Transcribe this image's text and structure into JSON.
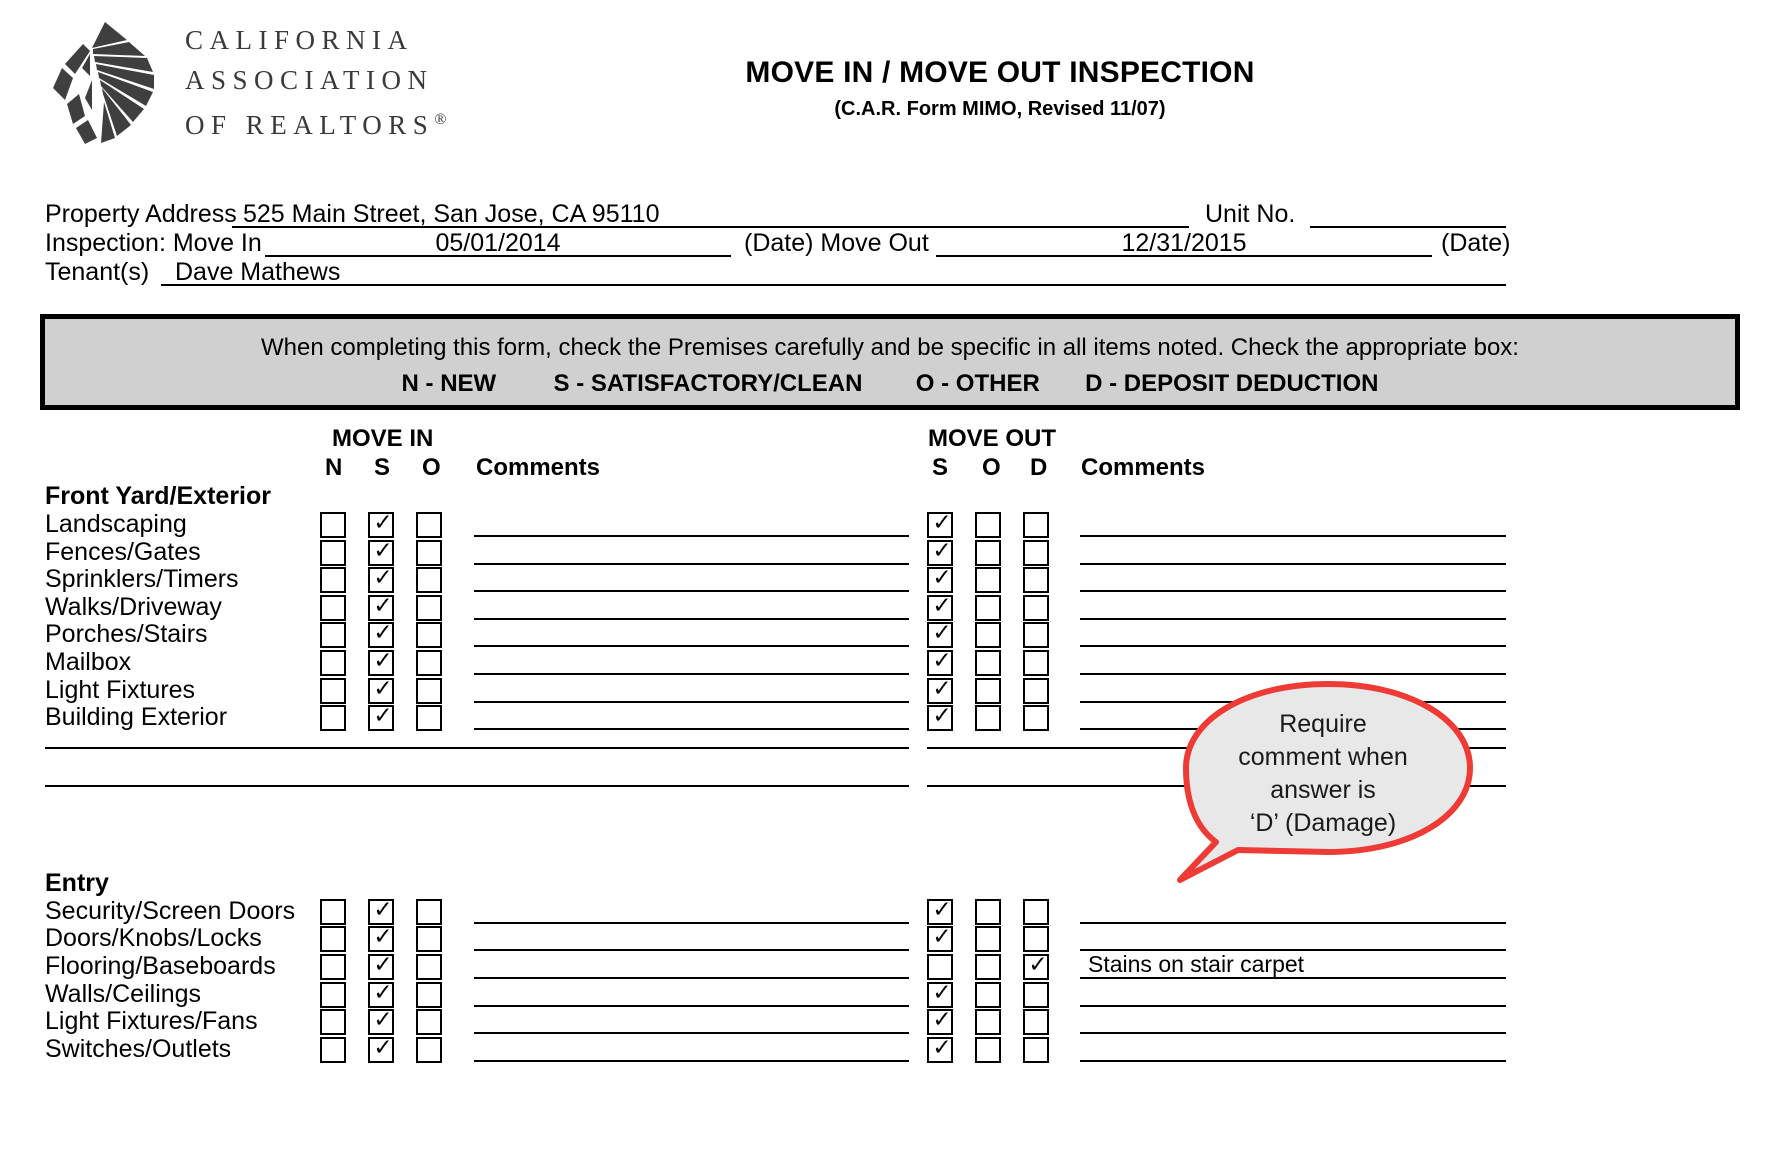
{
  "header": {
    "logo_lines": [
      "CALIFORNIA",
      "ASSOCIATION",
      "OF REALTORS"
    ],
    "logo_registered": "®",
    "title": "MOVE IN / MOVE OUT INSPECTION",
    "subtitle": "(C.A.R. Form MIMO, Revised 11/07)"
  },
  "fields": {
    "property_address_label": "Property Address",
    "property_address_value": "525 Main Street, San Jose, CA 95110",
    "unit_no_label": "Unit No.",
    "unit_no_value": "",
    "inspection_label": "Inspection: Move In",
    "move_in_value": "05/01/2014",
    "date_label_1": "(Date) Move Out",
    "move_out_value": "12/31/2015",
    "date_label_2": "(Date)",
    "tenants_label": "Tenant(s)",
    "tenants_value": "Dave Mathews"
  },
  "instructions": {
    "line1": "When completing this form, check the Premises carefully and be specific in all items noted. Check the appropriate box:",
    "codes": [
      "N - NEW",
      "S - SATISFACTORY/CLEAN",
      "O - OTHER",
      "D - DEPOSIT DEDUCTION"
    ]
  },
  "columns": {
    "move_in_title": "MOVE IN",
    "move_in_headers": [
      "N",
      "S",
      "O"
    ],
    "move_in_comments": "Comments",
    "move_out_title": "MOVE OUT",
    "move_out_headers": [
      "S",
      "O",
      "D"
    ],
    "move_out_comments": "Comments"
  },
  "checkmark": "✓",
  "sections": [
    {
      "title": "Front Yard/Exterior",
      "rows": [
        {
          "label": "Landscaping",
          "move_in": [
            false,
            true,
            false
          ],
          "move_in_comment": "",
          "move_out": [
            true,
            false,
            false
          ],
          "move_out_comment": ""
        },
        {
          "label": "Fences/Gates",
          "move_in": [
            false,
            true,
            false
          ],
          "move_in_comment": "",
          "move_out": [
            true,
            false,
            false
          ],
          "move_out_comment": ""
        },
        {
          "label": "Sprinklers/Timers",
          "move_in": [
            false,
            true,
            false
          ],
          "move_in_comment": "",
          "move_out": [
            true,
            false,
            false
          ],
          "move_out_comment": ""
        },
        {
          "label": "Walks/Driveway",
          "move_in": [
            false,
            true,
            false
          ],
          "move_in_comment": "",
          "move_out": [
            true,
            false,
            false
          ],
          "move_out_comment": ""
        },
        {
          "label": "Porches/Stairs",
          "move_in": [
            false,
            true,
            false
          ],
          "move_in_comment": "",
          "move_out": [
            true,
            false,
            false
          ],
          "move_out_comment": ""
        },
        {
          "label": "Mailbox",
          "move_in": [
            false,
            true,
            false
          ],
          "move_in_comment": "",
          "move_out": [
            true,
            false,
            false
          ],
          "move_out_comment": ""
        },
        {
          "label": "Light Fixtures",
          "move_in": [
            false,
            true,
            false
          ],
          "move_in_comment": "",
          "move_out": [
            true,
            false,
            false
          ],
          "move_out_comment": ""
        },
        {
          "label": "Building Exterior",
          "move_in": [
            false,
            true,
            false
          ],
          "move_in_comment": "",
          "move_out": [
            true,
            false,
            false
          ],
          "move_out_comment": ""
        }
      ],
      "blank_rows": 2
    },
    {
      "title": "Entry",
      "rows": [
        {
          "label": "Security/Screen Doors",
          "move_in": [
            false,
            true,
            false
          ],
          "move_in_comment": "",
          "move_out": [
            true,
            false,
            false
          ],
          "move_out_comment": ""
        },
        {
          "label": "Doors/Knobs/Locks",
          "move_in": [
            false,
            true,
            false
          ],
          "move_in_comment": "",
          "move_out": [
            true,
            false,
            false
          ],
          "move_out_comment": ""
        },
        {
          "label": "Flooring/Baseboards",
          "move_in": [
            false,
            true,
            false
          ],
          "move_in_comment": "",
          "move_out": [
            false,
            false,
            true
          ],
          "move_out_comment": "Stains on stair carpet"
        },
        {
          "label": "Walls/Ceilings",
          "move_in": [
            false,
            true,
            false
          ],
          "move_in_comment": "",
          "move_out": [
            true,
            false,
            false
          ],
          "move_out_comment": ""
        },
        {
          "label": "Light Fixtures/Fans",
          "move_in": [
            false,
            true,
            false
          ],
          "move_in_comment": "",
          "move_out": [
            true,
            false,
            false
          ],
          "move_out_comment": ""
        },
        {
          "label": "Switches/Outlets",
          "move_in": [
            false,
            true,
            false
          ],
          "move_in_comment": "",
          "move_out": [
            true,
            false,
            false
          ],
          "move_out_comment": ""
        }
      ],
      "blank_rows": 0
    }
  ],
  "callout": {
    "text": "Require comment when answer is ‘D’ (Damage)",
    "lines": [
      "Require",
      "comment when",
      "answer is",
      "‘D’ (Damage)"
    ],
    "border_color": "#ee3b36",
    "fill_color": "#e8e8e8"
  }
}
